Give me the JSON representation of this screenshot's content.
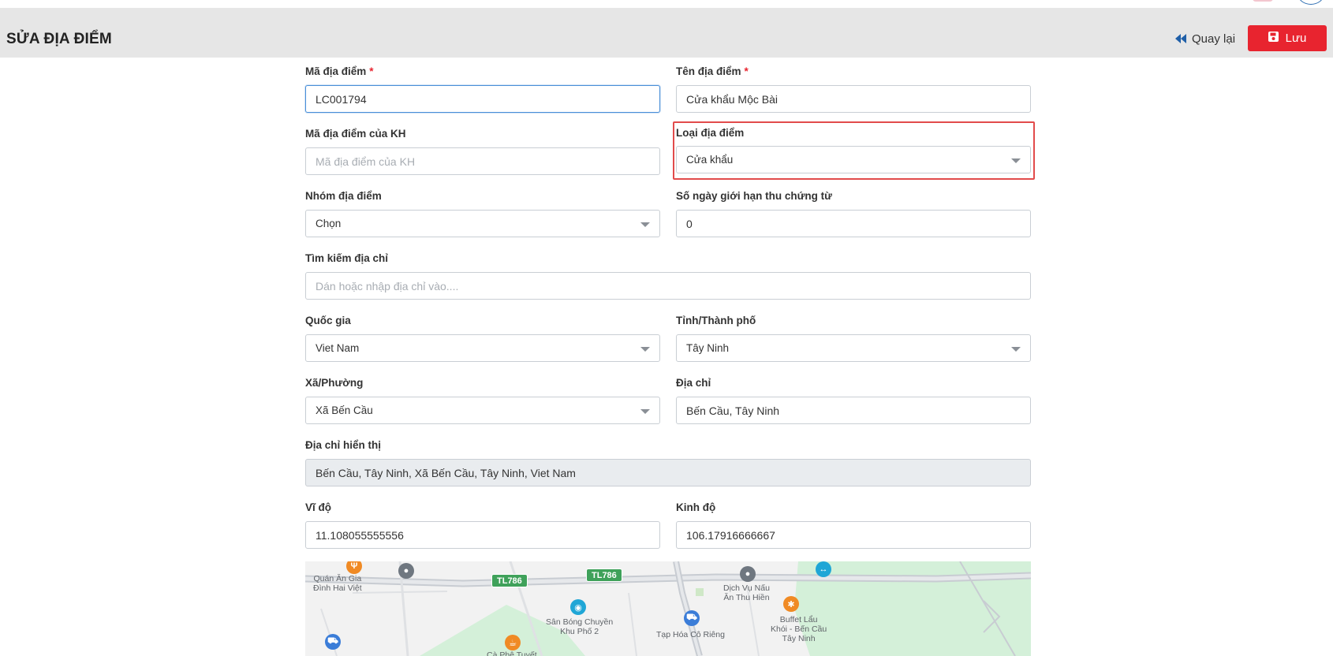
{
  "header": {
    "title": "SỬA ĐỊA ĐIỂM",
    "back_label": "Quay lại",
    "save_label": "Lưu"
  },
  "form": {
    "ma_dia_diem": {
      "label": "Mã địa điểm",
      "required_mark": "*",
      "value": "LC001794"
    },
    "ten_dia_diem": {
      "label": "Tên địa điểm",
      "required_mark": "*",
      "value": "Cửa khẩu Mộc Bài"
    },
    "ma_dia_diem_kh": {
      "label": "Mã địa điểm của KH",
      "placeholder": "Mã địa điểm của KH",
      "value": ""
    },
    "loai_dia_diem": {
      "label": "Loại địa điểm",
      "selected": "Cửa khẩu"
    },
    "nhom_dia_diem": {
      "label": "Nhóm địa điểm",
      "selected": "Chọn"
    },
    "so_ngay": {
      "label": "Số ngày giới hạn thu chứng từ",
      "value": "0"
    },
    "tim_kiem": {
      "label": "Tìm kiếm địa chỉ",
      "placeholder": "Dán hoặc nhập địa chỉ vào...."
    },
    "quoc_gia": {
      "label": "Quốc gia",
      "selected": "Viet Nam"
    },
    "tinh_thanh": {
      "label": "Tỉnh/Thành phố",
      "selected": "Tây Ninh"
    },
    "xa_phuong": {
      "label": "Xã/Phường",
      "selected": "Xã Bến Cầu"
    },
    "dia_chi": {
      "label": "Địa chỉ",
      "value": "Bến Cầu, Tây Ninh"
    },
    "dia_chi_hien_thi": {
      "label": "Địa chỉ hiển thị",
      "value": "Bến Cầu, Tây Ninh, Xã Bến Cầu, Tây Ninh, Viet Nam"
    },
    "vi_do": {
      "label": "Vĩ độ",
      "value": "11.108055555556"
    },
    "kinh_do": {
      "label": "Kinh độ",
      "value": "106.17916666667"
    }
  },
  "map": {
    "roads": [
      "TL786",
      "TL786"
    ],
    "places": [
      "Quán Ăn Gia\nĐình Hai Việt",
      "Dịch Vụ Nấu\nĂn Thu Hiền",
      "Sân Bóng Chuyền\nKhu Phố 2",
      "Tạp Hóa Cô Riêng",
      "Buffet Lẩu\nKhói - Bến Cầu\nTây Ninh",
      "Cà Phê Tuyết"
    ],
    "colors": {
      "park": "#d4f0d9",
      "road": "#c8ccd2",
      "road_badge": "#3fa15a"
    }
  },
  "colors": {
    "accent": "#e8242f",
    "header_bg": "#e6e6e6",
    "highlight": "#e24b4b"
  }
}
